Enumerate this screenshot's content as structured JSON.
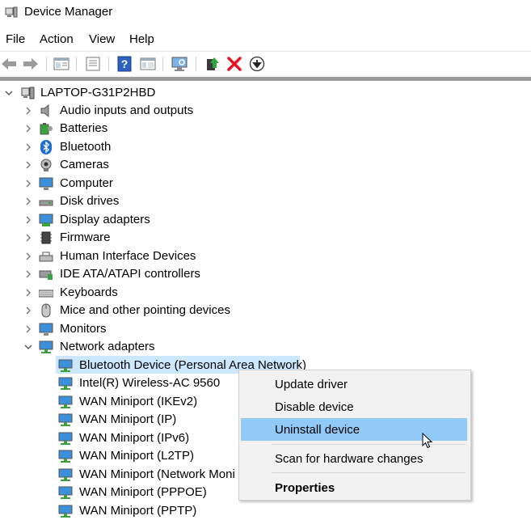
{
  "window": {
    "title": "Device Manager",
    "icon": "device-manager-icon"
  },
  "menu": [
    "File",
    "Action",
    "View",
    "Help"
  ],
  "toolbar": [
    "back-arrow-icon",
    "forward-arrow-icon",
    "properties-icon",
    "properties-sheet-icon",
    "help-icon",
    "view-pane-icon",
    "scan-monitor-icon",
    "update-driver-icon",
    "uninstall-x-icon",
    "download-circle-icon"
  ],
  "tree": {
    "root": "LAPTOP-G31P2HBD",
    "categories": [
      {
        "label": "Audio inputs and outputs",
        "icon": "speaker-icon"
      },
      {
        "label": "Batteries",
        "icon": "battery-icon"
      },
      {
        "label": "Bluetooth",
        "icon": "bluetooth-icon"
      },
      {
        "label": "Cameras",
        "icon": "camera-icon"
      },
      {
        "label": "Computer",
        "icon": "computer-icon"
      },
      {
        "label": "Disk drives",
        "icon": "disk-drive-icon"
      },
      {
        "label": "Display adapters",
        "icon": "display-adapter-icon"
      },
      {
        "label": "Firmware",
        "icon": "firmware-chip-icon"
      },
      {
        "label": "Human Interface Devices",
        "icon": "hid-icon"
      },
      {
        "label": "IDE ATA/ATAPI controllers",
        "icon": "ide-controller-icon"
      },
      {
        "label": "Keyboards",
        "icon": "keyboard-icon"
      },
      {
        "label": "Mice and other pointing devices",
        "icon": "mouse-icon"
      },
      {
        "label": "Monitors",
        "icon": "monitor-icon"
      },
      {
        "label": "Network adapters",
        "icon": "network-adapter-icon",
        "expanded": true
      }
    ],
    "network_children": [
      "Bluetooth Device (Personal Area Network)",
      "Intel(R) Wireless-AC 9560",
      "WAN Miniport (IKEv2)",
      "WAN Miniport (IP)",
      "WAN Miniport (IPv6)",
      "WAN Miniport (L2TP)",
      "WAN Miniport (Network Moni",
      "WAN Miniport (PPPOE)",
      "WAN Miniport (PPTP)"
    ]
  },
  "context_menu": {
    "items": [
      "Update driver",
      "Disable device",
      "Uninstall device",
      "Scan for hardware changes",
      "Properties"
    ],
    "highlighted": "Uninstall device"
  },
  "colors": {
    "selection": "#cce8ff",
    "menu_highlight": "#91c9f7",
    "uninstall_red": "#e81123"
  }
}
